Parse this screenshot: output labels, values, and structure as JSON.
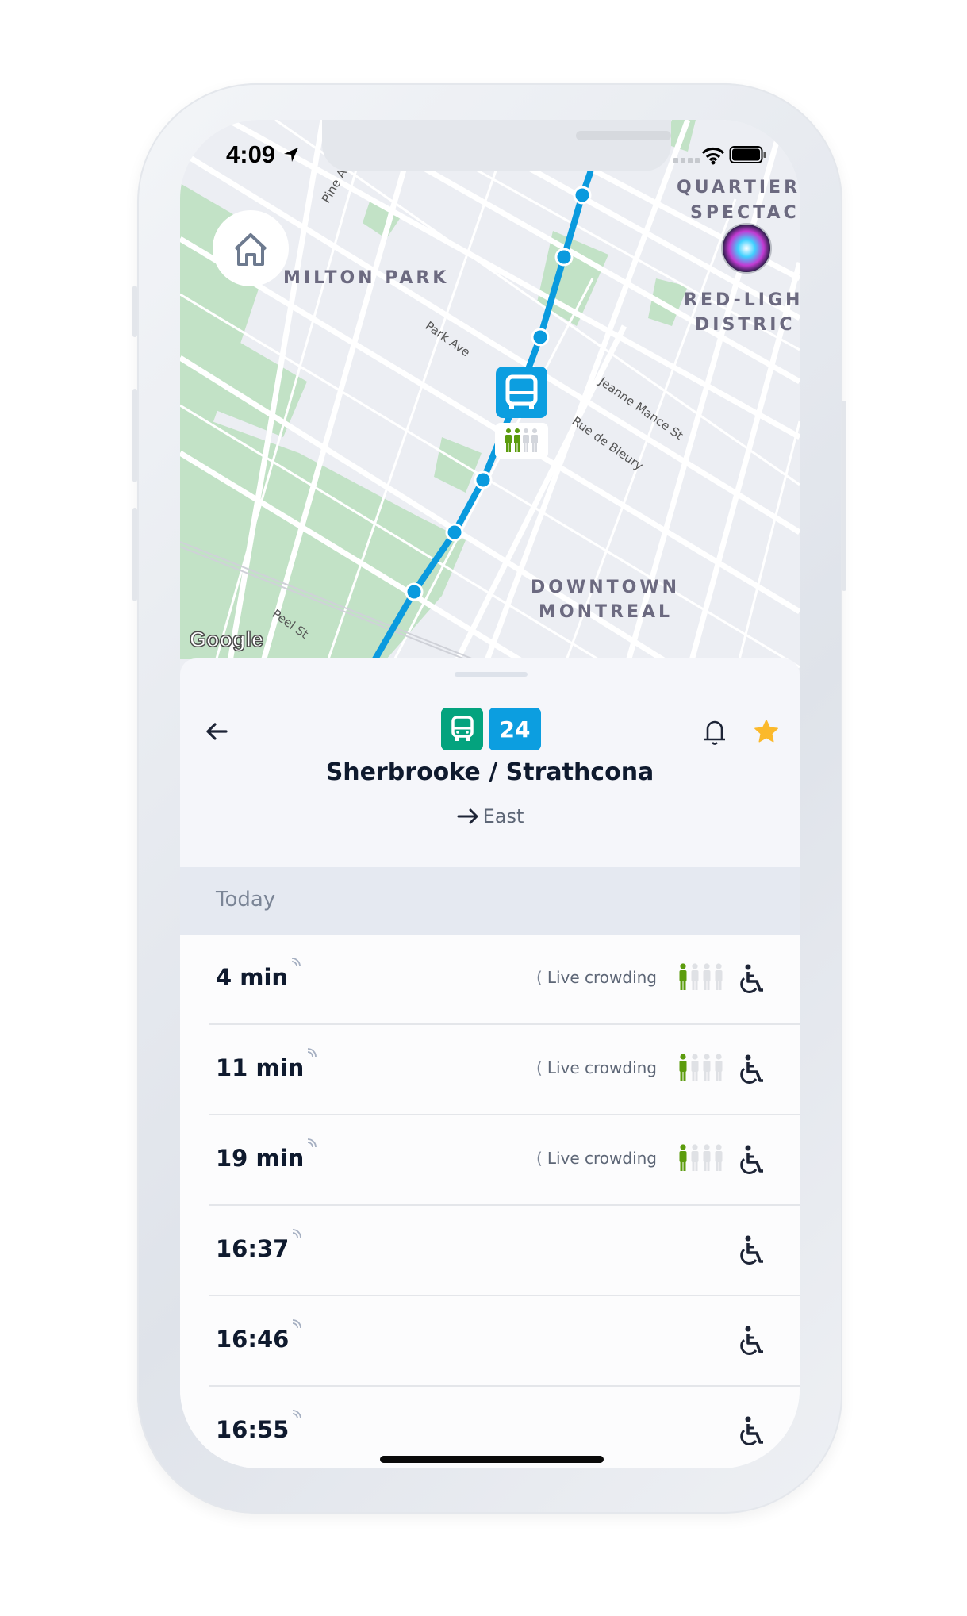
{
  "status_bar": {
    "time": "4:09",
    "location_icon": "location-arrow-icon",
    "wifi_icon": "wifi-icon",
    "battery_icon": "battery-icon"
  },
  "map": {
    "neighborhoods": [
      "MILTON PARK",
      "QUARTIER",
      "SPECTAC",
      "RED-LIGH",
      "DISTRIC",
      "DOWNTOWN",
      "MONTREAL"
    ],
    "streets": [
      "Park Ave",
      "Jeanne Mance St",
      "Rue de Bleury",
      "Peel St",
      "Pine A"
    ],
    "attribution": "Google",
    "vehicle_crowding": {
      "filled": 2,
      "total": 4
    },
    "route_color": "#0a9ade"
  },
  "route": {
    "mode_icon": "bus-icon",
    "mode_color": "#04a37e",
    "number": "24",
    "number_color": "#0c9ee0",
    "name": "Sherbrooke / Strathcona",
    "direction": "East",
    "favorite": true,
    "favorite_color": "#fbb92b"
  },
  "schedule": {
    "section_label": "Today",
    "departures": [
      {
        "time": "4 min",
        "realtime": true,
        "live_label": "Live crowding",
        "crowding": 1,
        "accessible": true
      },
      {
        "time": "11 min",
        "realtime": true,
        "live_label": "Live crowding",
        "crowding": 1,
        "accessible": true
      },
      {
        "time": "19 min",
        "realtime": true,
        "live_label": "Live crowding",
        "crowding": 1,
        "accessible": true
      },
      {
        "time": "16:37",
        "realtime": true,
        "accessible": true
      },
      {
        "time": "16:46",
        "realtime": true,
        "accessible": true
      },
      {
        "time": "16:55",
        "realtime": true,
        "accessible": true
      }
    ],
    "crowding_total": 4,
    "crowding_color": "#5c9c0e"
  }
}
